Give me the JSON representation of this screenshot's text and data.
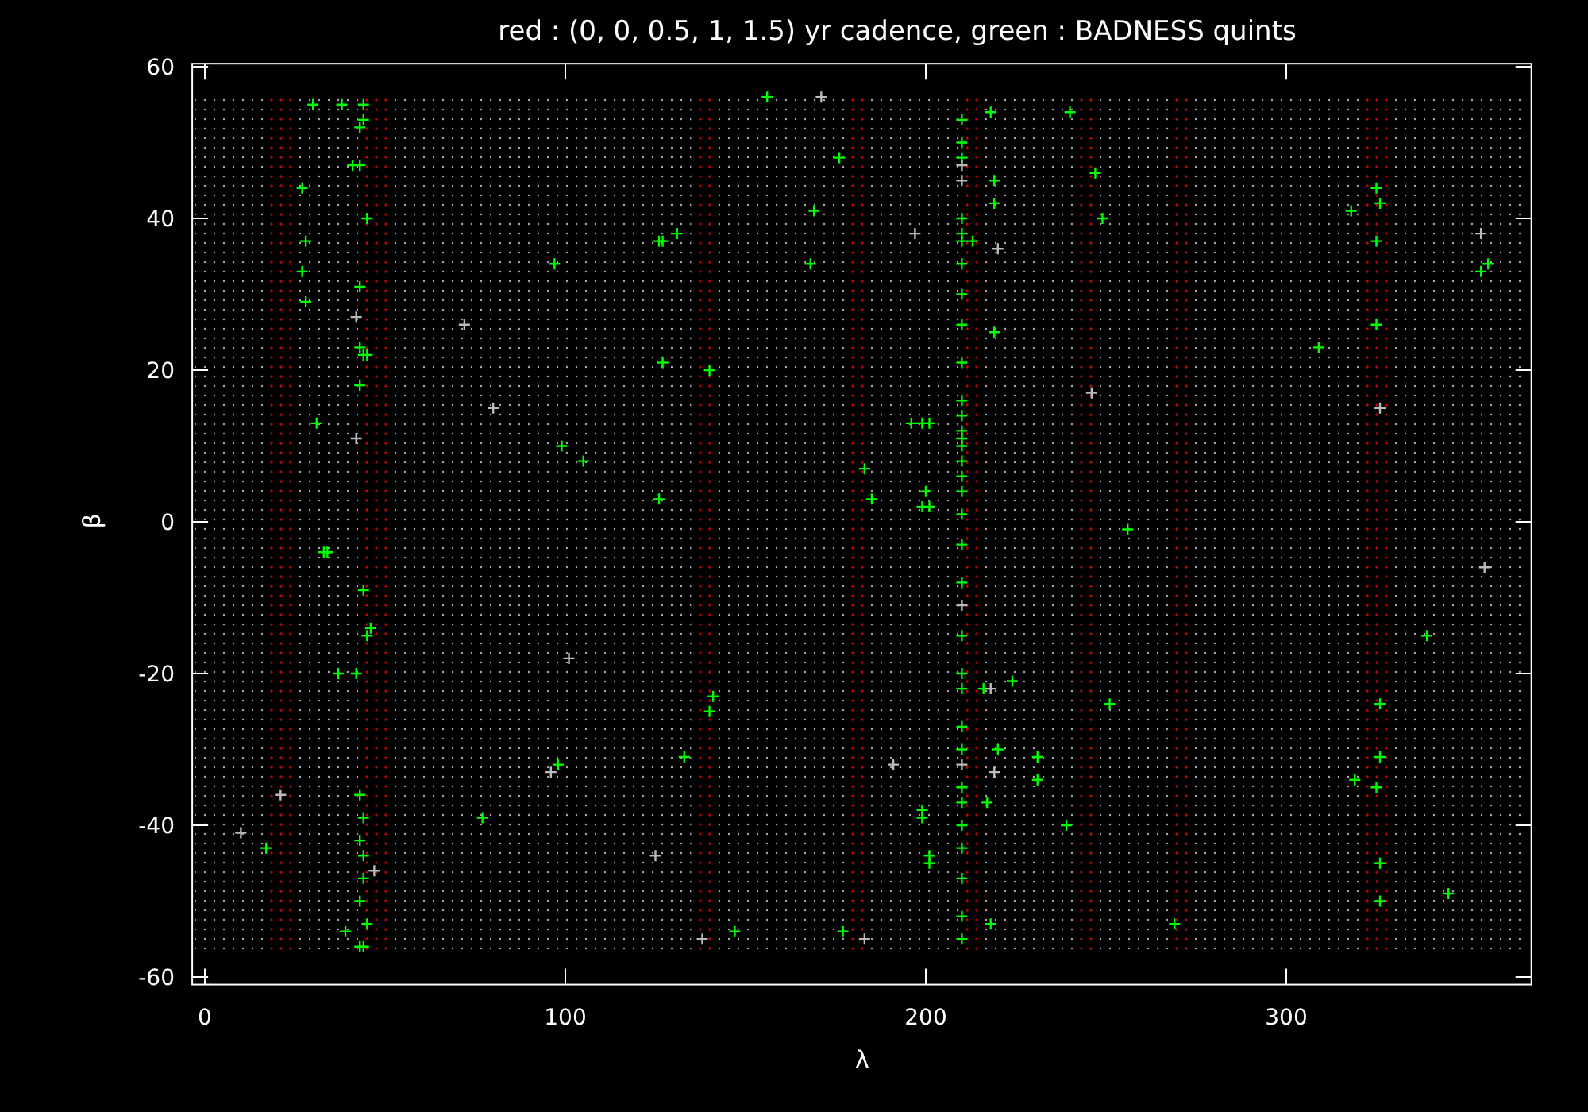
{
  "chart_data": {
    "type": "scatter",
    "title": "red : (0, 0, 0.5, 1, 1.5) yr cadence, green : BADNESS quints",
    "xlabel": "λ",
    "ylabel": "β",
    "xlim": [
      -3.5,
      368
    ],
    "ylim": [
      -61,
      60.4
    ],
    "xticks": [
      {
        "value": 0,
        "label": "0"
      },
      {
        "value": 100,
        "label": "100"
      },
      {
        "value": 200,
        "label": "200"
      },
      {
        "value": 300,
        "label": "300"
      }
    ],
    "yticks": [
      {
        "value": -60,
        "label": "-60"
      },
      {
        "value": -40,
        "label": "-40"
      },
      {
        "value": -20,
        "label": "-20"
      },
      {
        "value": 0,
        "label": "0"
      },
      {
        "value": 20,
        "label": "20"
      },
      {
        "value": 40,
        "label": "40"
      },
      {
        "value": 60,
        "label": "60"
      }
    ],
    "series": [
      {
        "color": "#00ff00",
        "x": [
          27,
          28,
          27,
          28,
          30,
          31,
          33,
          34,
          17,
          37,
          38,
          39,
          41,
          43,
          44,
          44,
          43,
          43,
          43,
          44,
          45,
          43,
          45,
          44,
          45,
          46,
          42,
          44,
          43,
          44,
          43,
          45,
          43,
          44,
          44,
          43,
          77,
          97,
          98,
          99,
          105,
          126,
          127,
          131,
          127,
          126,
          133,
          140,
          141,
          140,
          147,
          156,
          169,
          168,
          176,
          183,
          185,
          177,
          196,
          199,
          201,
          199,
          201,
          200,
          199,
          201,
          201,
          199,
          210,
          210,
          210,
          210,
          210,
          210,
          210,
          210,
          210,
          210,
          210,
          210,
          210,
          210,
          210,
          210,
          210,
          210,
          210,
          210,
          210,
          210,
          210,
          210,
          210,
          210,
          210,
          210,
          210,
          210,
          210,
          210,
          210,
          213,
          218,
          219,
          219,
          219,
          216,
          217,
          218,
          220,
          224,
          231,
          231,
          240,
          239,
          247,
          249,
          251,
          256,
          269,
          309,
          318,
          319,
          325,
          326,
          325,
          325,
          326,
          326,
          325,
          326,
          326,
          339,
          345,
          354,
          356
        ],
        "values": [
          44,
          37,
          33,
          29,
          55,
          13,
          -4,
          -4,
          -43,
          -20,
          55,
          -54,
          47,
          47,
          55,
          53,
          52,
          31,
          23,
          22,
          22,
          18,
          40,
          -9,
          -15,
          -14,
          -20,
          -39,
          -42,
          -44,
          -50,
          -53,
          -56,
          -56,
          -47,
          -36,
          -39,
          34,
          -32,
          10,
          8,
          37,
          37,
          38,
          21,
          3,
          -31,
          20,
          -23,
          -25,
          -54,
          56,
          41,
          34,
          48,
          7,
          3,
          -54,
          13,
          13,
          13,
          2,
          2,
          4,
          -39,
          -44,
          -45,
          -38,
          53,
          50,
          48,
          40,
          38,
          37,
          34,
          30,
          26,
          21,
          16,
          14,
          12,
          11,
          10,
          8,
          6,
          4,
          1,
          -15,
          -20,
          -22,
          -27,
          -30,
          -35,
          -37,
          -40,
          -43,
          -47,
          -52,
          -55,
          -8,
          -3,
          37,
          54,
          45,
          42,
          25,
          -22,
          -37,
          -53,
          -30,
          -21,
          -31,
          -34,
          54,
          -40,
          46,
          40,
          -24,
          -1,
          -53,
          23,
          41,
          -34,
          44,
          42,
          37,
          26,
          -24,
          -31,
          -35,
          -45,
          -50,
          -15,
          -49,
          33,
          34
        ]
      },
      {
        "color": "#bbbbbb",
        "x": [
          10,
          21,
          42,
          42,
          47,
          72,
          80,
          96,
          101,
          125,
          138,
          171,
          191,
          197,
          210,
          210,
          210,
          210,
          218,
          219,
          220,
          246,
          326,
          354,
          355,
          183
        ],
        "values": [
          -41,
          -36,
          27,
          11,
          -46,
          26,
          15,
          -33,
          -18,
          -44,
          -55,
          56,
          -32,
          38,
          47,
          45,
          -11,
          -32,
          -22,
          -33,
          36,
          17,
          15,
          38,
          -6,
          -55
        ]
      }
    ]
  }
}
